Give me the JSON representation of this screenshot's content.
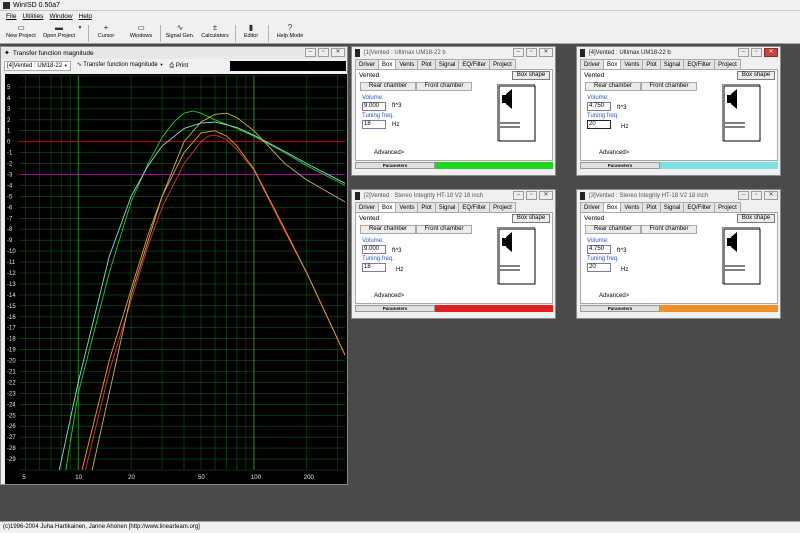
{
  "app": {
    "title": "WinISD 0.50a7"
  },
  "menu": [
    "File",
    "Utilities",
    "Window",
    "Help"
  ],
  "toolbar": {
    "new_project": "New Project",
    "open_project": "Open Project",
    "cursor": "Cursor",
    "windows": "Windows",
    "signal_gen": "Signal Gen.",
    "calculators": "Calculators",
    "editor": "Editor",
    "help_mode": "Help Mode"
  },
  "graph_window": {
    "title": "Transfer function magnitude",
    "project_select": "[4]Vented : UM18-22",
    "plot_select": "Transfer function magnitude",
    "print_label": "Print"
  },
  "chart_data": {
    "type": "line",
    "xscale": "log",
    "xlim": [
      4.6,
      330
    ],
    "ylim": [
      -30,
      6
    ],
    "x_tick_labels": [
      "5",
      "10",
      "20",
      "50",
      "100",
      "200"
    ],
    "y_ticks": [
      5,
      4,
      3,
      2,
      1,
      0,
      -1,
      -2,
      -3,
      -4,
      -5,
      -6,
      -7,
      -8,
      -9,
      -10,
      -11,
      -12,
      -13,
      -14,
      -15,
      -16,
      -17,
      -18,
      -19,
      -20,
      -21,
      -22,
      -23,
      -24,
      -25,
      -26,
      -27,
      -28,
      -29
    ],
    "reference_lines": [
      {
        "y": 0,
        "color": "#e00000"
      },
      {
        "y": -3,
        "color": "#c000c0"
      }
    ],
    "grid": true,
    "series": [
      {
        "color": "#22cc22",
        "points": [
          [
            8.5,
            -30
          ],
          [
            10,
            -23
          ],
          [
            15,
            -12
          ],
          [
            20,
            -5.5
          ],
          [
            25,
            -2
          ],
          [
            30,
            0.4
          ],
          [
            35,
            1.8
          ],
          [
            40,
            2.6
          ],
          [
            45,
            2.8
          ],
          [
            50,
            2.6
          ],
          [
            60,
            2.0
          ],
          [
            80,
            1.2
          ],
          [
            100,
            0.5
          ],
          [
            150,
            -1.0
          ],
          [
            200,
            -2.2
          ],
          [
            330,
            -4.0
          ]
        ]
      },
      {
        "color": "#80e0e0",
        "points": [
          [
            7.8,
            -30
          ],
          [
            10,
            -22
          ],
          [
            15,
            -10.5
          ],
          [
            20,
            -5
          ],
          [
            25,
            -2.2
          ],
          [
            30,
            -0.4
          ],
          [
            40,
            1.2
          ],
          [
            50,
            1.7
          ],
          [
            60,
            1.8
          ],
          [
            80,
            1.3
          ],
          [
            100,
            0.6
          ],
          [
            150,
            -0.9
          ],
          [
            200,
            -2.0
          ],
          [
            330,
            -3.8
          ]
        ]
      },
      {
        "color": "#e03030",
        "points": [
          [
            11,
            -30
          ],
          [
            15,
            -21
          ],
          [
            20,
            -14.5
          ],
          [
            25,
            -9.5
          ],
          [
            30,
            -6
          ],
          [
            40,
            -2
          ],
          [
            50,
            0
          ],
          [
            55,
            0.5
          ],
          [
            60,
            0.6
          ],
          [
            70,
            0.2
          ],
          [
            80,
            -0.7
          ],
          [
            100,
            -2.6
          ],
          [
            150,
            -8.2
          ],
          [
            200,
            -12
          ],
          [
            330,
            -19.5
          ]
        ]
      },
      {
        "color": "#f0a030",
        "points": [
          [
            10.5,
            -30
          ],
          [
            15,
            -20
          ],
          [
            20,
            -13.5
          ],
          [
            25,
            -8.5
          ],
          [
            30,
            -5
          ],
          [
            40,
            -1
          ],
          [
            50,
            0.8
          ],
          [
            60,
            1.0
          ],
          [
            70,
            0.5
          ],
          [
            80,
            -0.4
          ],
          [
            100,
            -2.5
          ],
          [
            150,
            -8
          ],
          [
            200,
            -12
          ],
          [
            330,
            -19.5
          ]
        ]
      },
      {
        "color": "#d0b060",
        "points": [
          [
            12,
            -30
          ],
          [
            15,
            -23
          ],
          [
            20,
            -14
          ],
          [
            30,
            -5
          ],
          [
            40,
            0
          ],
          [
            50,
            1.8
          ],
          [
            60,
            2.5
          ],
          [
            70,
            2.6
          ],
          [
            80,
            2.2
          ],
          [
            100,
            1.0
          ],
          [
            150,
            -2.0
          ],
          [
            200,
            -3.5
          ],
          [
            330,
            -5.5
          ]
        ]
      }
    ]
  },
  "box_windows": [
    {
      "id": "w1",
      "title": "[1]Vented : Ultimax UM18-22 b",
      "active_tab": "Box",
      "tabs": [
        "Driver",
        "Box",
        "Vents",
        "Plot",
        "Signal",
        "EQ/Filter",
        "Project"
      ],
      "vented": "Vented",
      "box_shape": "Box shape",
      "rear_chamber": "Rear chamber",
      "front_chamber": "Front chamber",
      "volume_label": "Volume:",
      "volume_value": "9.000",
      "volume_unit": "ft^3",
      "tuning_label": "Tuning freq.",
      "tuning_value": "18",
      "tuning_unit": "Hz",
      "advanced": "Advanced>",
      "parameters": "Parameters",
      "color": "#22d422"
    },
    {
      "id": "w4",
      "title": "[4]Vented : Ultimax UM18-22 b",
      "active_tab": "Box",
      "tabs": [
        "Driver",
        "Box",
        "Vents",
        "Plot",
        "Signal",
        "EQ/Filter",
        "Project"
      ],
      "vented": "Vented",
      "box_shape": "Box shape",
      "rear_chamber": "Rear chamber",
      "front_chamber": "Front chamber",
      "volume_label": "Volume:",
      "volume_value": "4.750",
      "volume_unit": "ft^3",
      "tuning_label": "Tuning freq.",
      "tuning_value": "20",
      "tuning_unit": "Hz",
      "advanced": "Advanced>",
      "parameters": "Parameters",
      "color": "#80e0e0"
    },
    {
      "id": "w2",
      "title": "[2]Vented : Stereo Integrity HT-18 V2 18 inch",
      "active_tab": "Box",
      "tabs": [
        "Driver",
        "Box",
        "Vents",
        "Plot",
        "Signal",
        "EQ/Filter",
        "Project"
      ],
      "vented": "Vented",
      "box_shape": "Box shape",
      "rear_chamber": "Rear chamber",
      "front_chamber": "Front chamber",
      "volume_label": "Volume:",
      "volume_value": "9.000",
      "volume_unit": "ft^3",
      "tuning_label": "Tuning freq.",
      "tuning_value": "18",
      "tuning_unit": "Hz",
      "advanced": "Advanced>",
      "parameters": "Parameters",
      "color": "#e02020"
    },
    {
      "id": "w3",
      "title": "[3]Vented : Stereo Integrity HT-18 V2 18 inch",
      "active_tab": "Box",
      "tabs": [
        "Driver",
        "Box",
        "Vents",
        "Plot",
        "Signal",
        "EQ/Filter",
        "Project"
      ],
      "vented": "Vented",
      "box_shape": "Box shape",
      "rear_chamber": "Rear chamber",
      "front_chamber": "Front chamber",
      "volume_label": "Volume:",
      "volume_value": "4.750",
      "volume_unit": "ft^3",
      "tuning_label": "Tuning freq.",
      "tuning_value": "20",
      "tuning_unit": "Hz",
      "advanced": "Advanced>",
      "parameters": "Parameters",
      "color": "#f0902a"
    }
  ],
  "status": {
    "text": "(c)1996-2004 Juha Hartikainen, Janne Ahonen [http://www.linearteam.org]"
  }
}
